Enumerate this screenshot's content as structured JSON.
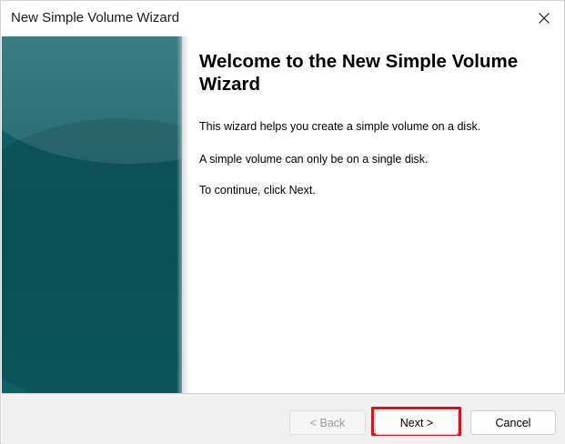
{
  "window": {
    "title": "New Simple Volume Wizard"
  },
  "content": {
    "heading": "Welcome to the New Simple Volume Wizard",
    "paragraphs": [
      "This wizard helps you create a simple volume on a disk.",
      "A simple volume can only be on a single disk.",
      "To continue, click Next."
    ]
  },
  "footer": {
    "back_label": "< Back",
    "next_label": "Next >",
    "cancel_label": "Cancel"
  },
  "colors": {
    "side_panel": "#0f5c64",
    "highlight": "#d5121f",
    "footer_bg": "#f0f0f0"
  },
  "icons": {
    "close": "close-icon"
  }
}
